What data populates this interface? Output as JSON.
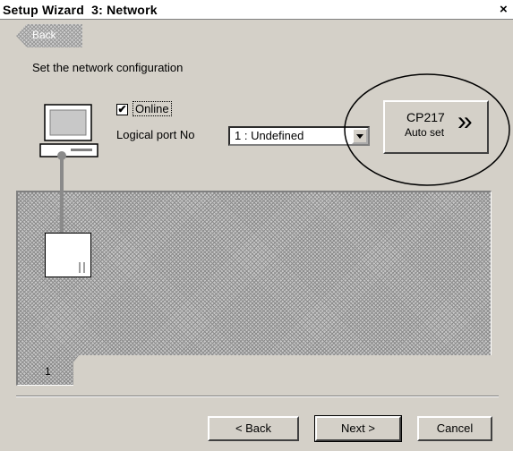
{
  "window": {
    "title": "Setup Wizard  3: Network",
    "close_label": "×"
  },
  "back_tab": {
    "label": "Back"
  },
  "instruction": "Set the network configuration",
  "online": {
    "label": "Online",
    "checked": true,
    "check_mark": "✔"
  },
  "logical_port": {
    "label": "Logical port No",
    "value": "1 : Undefined"
  },
  "cp_button": {
    "line1": "CP217",
    "line2": "Auto set",
    "chevrons": "»"
  },
  "rack": {
    "tab_label": "1"
  },
  "buttons": {
    "back": "< Back",
    "next": "Next >",
    "cancel": "Cancel"
  },
  "icons": [
    "close-icon",
    "back-arrow-icon",
    "pc-monitor-icon",
    "dropdown-arrow-icon",
    "double-chevron-icon",
    "station-module-icon"
  ],
  "colors": {
    "window_bg": "#d4d0c8",
    "hatch": "#8c8c8c",
    "connector": "#8a8a8a"
  }
}
